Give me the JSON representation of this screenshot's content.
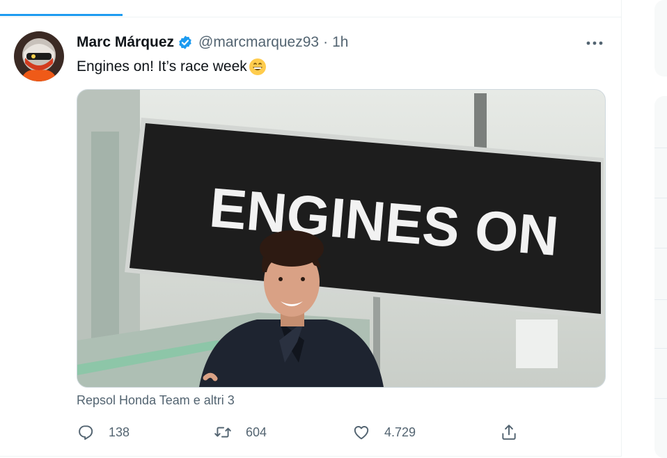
{
  "tweet": {
    "author_name": "Marc Márquez",
    "handle": "@marcmarquez93",
    "separator": "·",
    "time": "1h",
    "text": "Engines on! It’s race week",
    "emoji": "grinning-face-icon",
    "more_icon": "more-horizontal-icon",
    "verified_icon": "verified-badge-icon",
    "media": {
      "sign_text": "ENGINES ON",
      "description": "photo"
    },
    "tagged_caption": "Repsol Honda Team e altri 3",
    "actions": {
      "reply_count": "138",
      "retweet_count": "604",
      "like_count": "4.729",
      "reply_icon": "reply-icon",
      "retweet_icon": "retweet-icon",
      "like_icon": "heart-icon",
      "share_icon": "share-icon"
    }
  },
  "colors": {
    "accent": "#1d9bf0",
    "secondary_text": "#536471",
    "primary_text": "#0f1419",
    "border": "#cfd9de"
  }
}
